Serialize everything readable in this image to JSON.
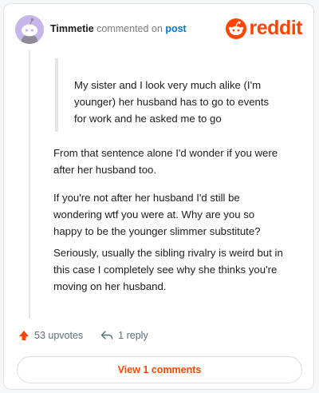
{
  "header": {
    "username": "Timmetie",
    "action_text": "commented on",
    "post_link": "post"
  },
  "logo": {
    "text": "reddit",
    "icon": "reddit-snoo-icon"
  },
  "quote": {
    "lines": [
      "My sister and I look very much alike (I'm",
      "younger) her husband has to go to events",
      "for work and he asked me to go"
    ]
  },
  "comment": {
    "paragraphs": [
      [
        "From that sentence alone I'd wonder if you were",
        "after her husband too."
      ],
      [
        "If you're not after her husband I'd still be",
        "wondering wtf you were at. Why are you so",
        "happy to be the younger slimmer substitute?"
      ],
      [
        "Seriously, usually the sibling rivalry is weird but in",
        "this case I completely see why she thinks you're",
        "moving on her husband."
      ]
    ]
  },
  "actions": {
    "upvotes_label": "53 upvotes",
    "reply_label": "1 reply",
    "upvote_icon": "upvote-arrow-icon",
    "reply_icon": "reply-arrow-icon"
  },
  "view_comments_label": "View 1 comments",
  "colors": {
    "brand": "#ff4500",
    "link": "#0079d3",
    "avatar_bg": "#c7b6ea"
  }
}
